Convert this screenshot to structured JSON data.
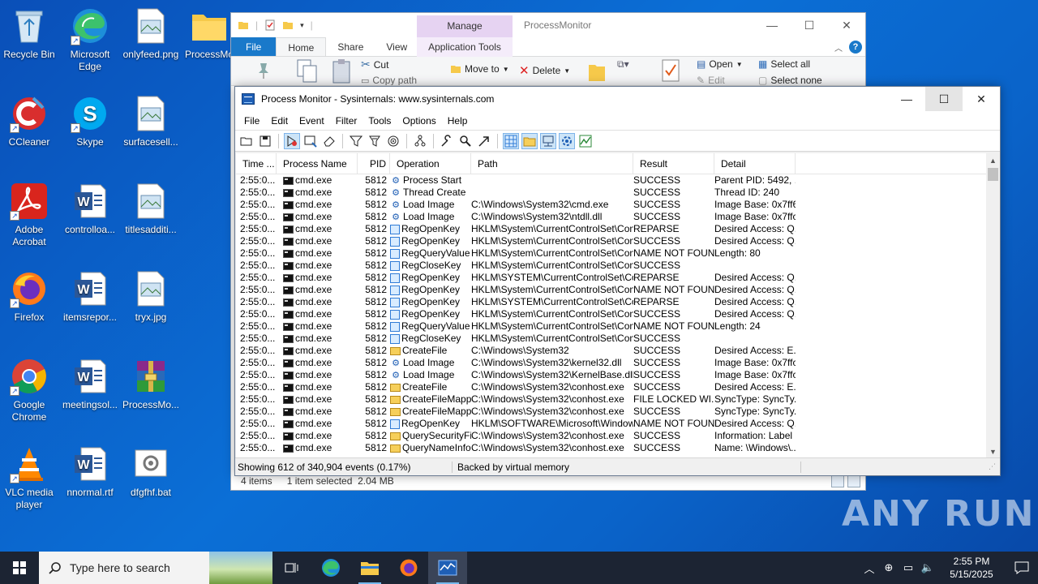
{
  "desktop": {
    "icons": [
      {
        "label": "Recycle Bin"
      },
      {
        "label": "Microsoft Edge"
      },
      {
        "label": "onlyfeed.png"
      },
      {
        "label": "ProcessMo"
      },
      {
        "label": "CCleaner"
      },
      {
        "label": "Skype"
      },
      {
        "label": "surfacesell..."
      },
      {
        "label": "Adobe Acrobat"
      },
      {
        "label": "controlloa..."
      },
      {
        "label": "titlesadditi..."
      },
      {
        "label": "Firefox"
      },
      {
        "label": "itemsrepor..."
      },
      {
        "label": "tryx.jpg"
      },
      {
        "label": "Google Chrome"
      },
      {
        "label": "meetingsol..."
      },
      {
        "label": "ProcessMo..."
      },
      {
        "label": "VLC media player"
      },
      {
        "label": "nnormal.rtf"
      },
      {
        "label": "dfgfhf.bat"
      }
    ]
  },
  "explorer": {
    "manage_label": "Manage",
    "title": "ProcessMonitor",
    "tabs": {
      "file": "File",
      "home": "Home",
      "share": "Share",
      "view": "View",
      "app_tools": "Application Tools"
    },
    "ribbon": {
      "cut": "Cut",
      "copy_path": "Copy path",
      "move_to": "Move to",
      "delete": "Delete",
      "open": "Open",
      "edit": "Edit",
      "select_all": "Select all",
      "select_none": "Select none"
    },
    "status": {
      "items": "4 items",
      "selected": "1 item selected",
      "size": "2.04 MB"
    }
  },
  "procmon": {
    "title": "Process Monitor - Sysinternals: www.sysinternals.com",
    "menu": [
      "File",
      "Edit",
      "Event",
      "Filter",
      "Tools",
      "Options",
      "Help"
    ],
    "columns": {
      "time": "Time ...",
      "process": "Process Name",
      "pid": "PID",
      "operation": "Operation",
      "path": "Path",
      "result": "Result",
      "detail": "Detail"
    },
    "rows": [
      {
        "time": "2:55:0...",
        "proc": "cmd.exe",
        "pid": "5812",
        "kind": "proc",
        "op": "Process Start",
        "path": "",
        "result": "SUCCESS",
        "detail": "Parent PID: 5492, ..."
      },
      {
        "time": "2:55:0...",
        "proc": "cmd.exe",
        "pid": "5812",
        "kind": "proc",
        "op": "Thread Create",
        "path": "",
        "result": "SUCCESS",
        "detail": "Thread ID: 240"
      },
      {
        "time": "2:55:0...",
        "proc": "cmd.exe",
        "pid": "5812",
        "kind": "proc",
        "op": "Load Image",
        "path": "C:\\Windows\\System32\\cmd.exe",
        "result": "SUCCESS",
        "detail": "Image Base: 0x7ff6..."
      },
      {
        "time": "2:55:0...",
        "proc": "cmd.exe",
        "pid": "5812",
        "kind": "proc",
        "op": "Load Image",
        "path": "C:\\Windows\\System32\\ntdll.dll",
        "result": "SUCCESS",
        "detail": "Image Base: 0x7ffc..."
      },
      {
        "time": "2:55:0...",
        "proc": "cmd.exe",
        "pid": "5812",
        "kind": "reg",
        "op": "RegOpenKey",
        "path": "HKLM\\System\\CurrentControlSet\\Contr...",
        "result": "REPARSE",
        "detail": "Desired Access: Q..."
      },
      {
        "time": "2:55:0...",
        "proc": "cmd.exe",
        "pid": "5812",
        "kind": "reg",
        "op": "RegOpenKey",
        "path": "HKLM\\System\\CurrentControlSet\\Contr...",
        "result": "SUCCESS",
        "detail": "Desired Access: Q..."
      },
      {
        "time": "2:55:0...",
        "proc": "cmd.exe",
        "pid": "5812",
        "kind": "reg",
        "op": "RegQueryValue",
        "path": "HKLM\\System\\CurrentControlSet\\Contr...",
        "result": "NAME NOT FOUND",
        "detail": "Length: 80"
      },
      {
        "time": "2:55:0...",
        "proc": "cmd.exe",
        "pid": "5812",
        "kind": "reg",
        "op": "RegCloseKey",
        "path": "HKLM\\System\\CurrentControlSet\\Contr...",
        "result": "SUCCESS",
        "detail": ""
      },
      {
        "time": "2:55:0...",
        "proc": "cmd.exe",
        "pid": "5812",
        "kind": "reg",
        "op": "RegOpenKey",
        "path": "HKLM\\SYSTEM\\CurrentControlSet\\Con...",
        "result": "REPARSE",
        "detail": "Desired Access: Q..."
      },
      {
        "time": "2:55:0...",
        "proc": "cmd.exe",
        "pid": "5812",
        "kind": "reg",
        "op": "RegOpenKey",
        "path": "HKLM\\System\\CurrentControlSet\\Contr...",
        "result": "NAME NOT FOUND",
        "detail": "Desired Access: Q..."
      },
      {
        "time": "2:55:0...",
        "proc": "cmd.exe",
        "pid": "5812",
        "kind": "reg",
        "op": "RegOpenKey",
        "path": "HKLM\\SYSTEM\\CurrentControlSet\\Con...",
        "result": "REPARSE",
        "detail": "Desired Access: Q..."
      },
      {
        "time": "2:55:0...",
        "proc": "cmd.exe",
        "pid": "5812",
        "kind": "reg",
        "op": "RegOpenKey",
        "path": "HKLM\\System\\CurrentControlSet\\Contr...",
        "result": "SUCCESS",
        "detail": "Desired Access: Q..."
      },
      {
        "time": "2:55:0...",
        "proc": "cmd.exe",
        "pid": "5812",
        "kind": "reg",
        "op": "RegQueryValue",
        "path": "HKLM\\System\\CurrentControlSet\\Contr...",
        "result": "NAME NOT FOUND",
        "detail": "Length: 24"
      },
      {
        "time": "2:55:0...",
        "proc": "cmd.exe",
        "pid": "5812",
        "kind": "reg",
        "op": "RegCloseKey",
        "path": "HKLM\\System\\CurrentControlSet\\Contr...",
        "result": "SUCCESS",
        "detail": ""
      },
      {
        "time": "2:55:0...",
        "proc": "cmd.exe",
        "pid": "5812",
        "kind": "file",
        "op": "CreateFile",
        "path": "C:\\Windows\\System32",
        "result": "SUCCESS",
        "detail": "Desired Access: E..."
      },
      {
        "time": "2:55:0...",
        "proc": "cmd.exe",
        "pid": "5812",
        "kind": "proc",
        "op": "Load Image",
        "path": "C:\\Windows\\System32\\kernel32.dll",
        "result": "SUCCESS",
        "detail": "Image Base: 0x7ffc..."
      },
      {
        "time": "2:55:0...",
        "proc": "cmd.exe",
        "pid": "5812",
        "kind": "proc",
        "op": "Load Image",
        "path": "C:\\Windows\\System32\\KernelBase.dll",
        "result": "SUCCESS",
        "detail": "Image Base: 0x7ffc..."
      },
      {
        "time": "2:55:0...",
        "proc": "cmd.exe",
        "pid": "5812",
        "kind": "file",
        "op": "CreateFile",
        "path": "C:\\Windows\\System32\\conhost.exe",
        "result": "SUCCESS",
        "detail": "Desired Access: E..."
      },
      {
        "time": "2:55:0...",
        "proc": "cmd.exe",
        "pid": "5812",
        "kind": "file",
        "op": "CreateFileMapp...",
        "path": "C:\\Windows\\System32\\conhost.exe",
        "result": "FILE LOCKED WI...",
        "detail": "SyncType: SyncTy..."
      },
      {
        "time": "2:55:0...",
        "proc": "cmd.exe",
        "pid": "5812",
        "kind": "file",
        "op": "CreateFileMapp...",
        "path": "C:\\Windows\\System32\\conhost.exe",
        "result": "SUCCESS",
        "detail": "SyncType: SyncTy..."
      },
      {
        "time": "2:55:0...",
        "proc": "cmd.exe",
        "pid": "5812",
        "kind": "reg",
        "op": "RegOpenKey",
        "path": "HKLM\\SOFTWARE\\Microsoft\\Window...",
        "result": "NAME NOT FOUND",
        "detail": "Desired Access: Q..."
      },
      {
        "time": "2:55:0...",
        "proc": "cmd.exe",
        "pid": "5812",
        "kind": "file",
        "op": "QuerySecurityFile",
        "path": "C:\\Windows\\System32\\conhost.exe",
        "result": "SUCCESS",
        "detail": "Information: Label"
      },
      {
        "time": "2:55:0...",
        "proc": "cmd.exe",
        "pid": "5812",
        "kind": "file",
        "op": "QueryNameInfo...",
        "path": "C:\\Windows\\System32\\conhost.exe",
        "result": "SUCCESS",
        "detail": "Name: \\Windows\\..."
      }
    ],
    "status": {
      "events": "Showing 612 of 340,904 events (0.17%)",
      "memory": "Backed by virtual memory"
    }
  },
  "taskbar": {
    "search_placeholder": "Type here to search",
    "time": "2:55 PM",
    "date": "5/15/2025"
  },
  "watermark": "ANY RUN"
}
